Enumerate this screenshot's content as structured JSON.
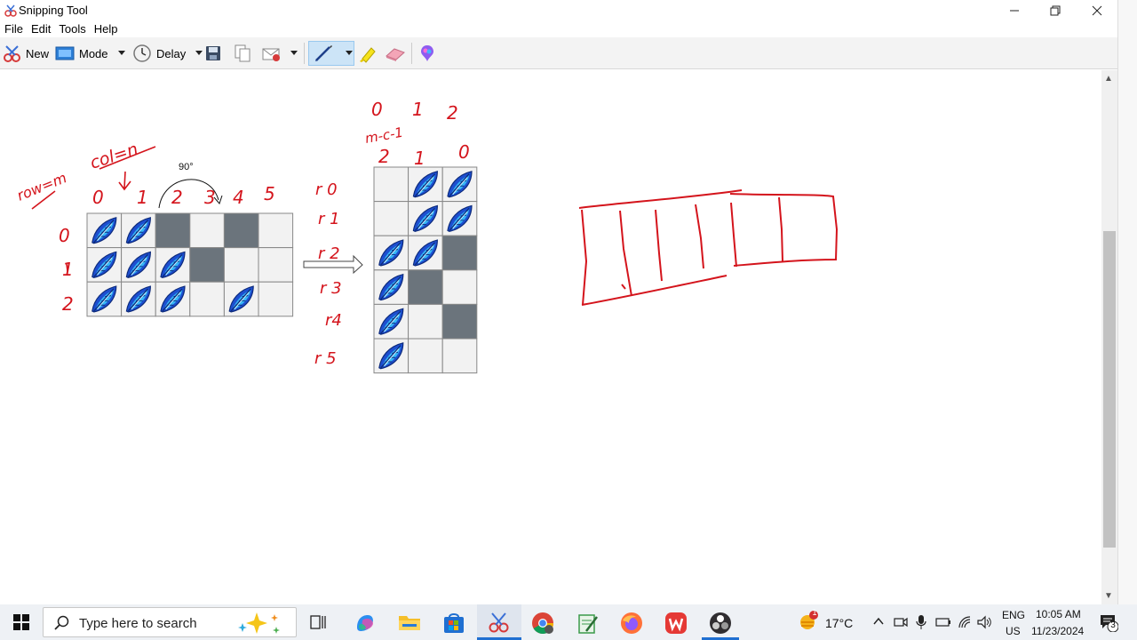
{
  "window": {
    "title": "Snipping Tool",
    "icon": "snipping-tool-icon",
    "controls": [
      "minimize-icon",
      "restore-icon",
      "close-icon"
    ]
  },
  "menu": [
    "File",
    "Edit",
    "Tools",
    "Help"
  ],
  "toolbar": {
    "new_label": "New",
    "mode_label": "Mode",
    "delay_label": "Delay",
    "icons": [
      "new-snip-icon",
      "mode-icon",
      "delay-clock-icon",
      "save-icon",
      "copy-icon",
      "send-email-icon",
      "pen-icon",
      "highlighter-icon",
      "eraser-icon",
      "paint3d-icon"
    ]
  },
  "canvas": {
    "left_grid": {
      "rows": 3,
      "cols": 6,
      "cells": [
        [
          "leaf",
          "leaf",
          "dark",
          "empty",
          "dark",
          "empty"
        ],
        [
          "leaf",
          "leaf",
          "leaf",
          "dark",
          "empty",
          "empty"
        ],
        [
          "leaf",
          "leaf",
          "leaf",
          "empty",
          "leaf",
          "empty"
        ]
      ]
    },
    "rotation_label": "90°",
    "right_grid": {
      "rows": 6,
      "cols": 3,
      "cells": [
        [
          "empty",
          "leaf",
          "leaf"
        ],
        [
          "empty",
          "leaf",
          "leaf"
        ],
        [
          "leaf",
          "leaf",
          "dark"
        ],
        [
          "leaf",
          "dark",
          "empty"
        ],
        [
          "leaf",
          "empty",
          "dark"
        ],
        [
          "leaf",
          "empty",
          "empty"
        ]
      ]
    },
    "handwriting": {
      "rows_eq": "row=m",
      "col_eq": "col=n",
      "left_col_indices": [
        "0",
        "1",
        "2",
        "3",
        "4",
        "5"
      ],
      "left_row_indices": [
        "0",
        "1",
        "2"
      ],
      "right_col_indices": [
        "0",
        "1",
        "2"
      ],
      "formula": "m-c-1",
      "right_col_indices_rev": [
        "2",
        "1",
        "0"
      ],
      "right_row_labels": [
        "r 0",
        "r 1",
        "r 2",
        "r 3",
        "r4",
        "r 5"
      ]
    },
    "ink_color": "#d4141c",
    "dark_cell_color": "#6b747c"
  },
  "taskbar": {
    "search_placeholder": "Type here to search",
    "weather_temp": "17°C",
    "weather_badge": "1",
    "language_top": "ENG",
    "language_bottom": "US",
    "time": "10:05 AM",
    "date": "11/23/2024",
    "notification_count": "3",
    "pinned": [
      "start-icon",
      "task-view-icon",
      "copilot-icon",
      "file-explorer-icon",
      "store-icon",
      "snipping-tool-icon",
      "chrome-icon",
      "notepad-icon",
      "firefox-icon",
      "wps-icon",
      "obs-icon"
    ]
  }
}
